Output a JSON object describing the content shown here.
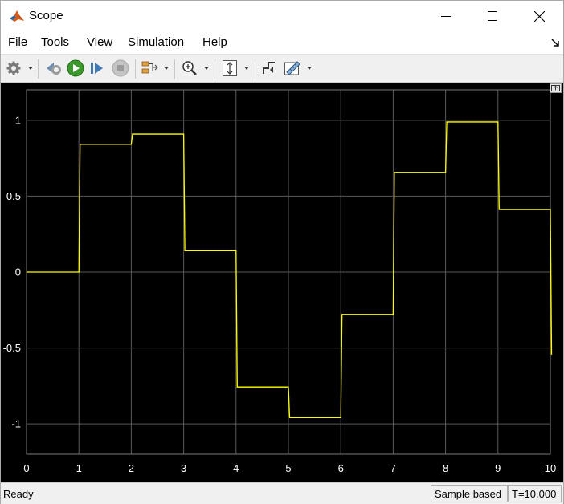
{
  "window": {
    "title": "Scope"
  },
  "menu": {
    "items": [
      "File",
      "Tools",
      "View",
      "Simulation",
      "Help"
    ]
  },
  "toolbar": {
    "icons": [
      "gear-icon",
      "step-back-icon",
      "run-icon",
      "step-forward-icon",
      "stop-icon",
      "signal-select-icon",
      "zoom-in-icon",
      "scale-axes-icon",
      "triggers-icon",
      "measurements-icon"
    ]
  },
  "status": {
    "left": "Ready",
    "mode": "Sample based",
    "time": "T=10.000"
  },
  "colors": {
    "plot_bg": "#000000",
    "grid": "#5a5a5a",
    "trace": "#ffff00",
    "tick_text": "#ffffff"
  },
  "chart_data": {
    "type": "line",
    "step": true,
    "x": [
      0,
      1,
      2,
      3,
      4,
      5,
      6,
      7,
      8,
      9,
      10
    ],
    "series": [
      {
        "values": [
          0,
          0.841,
          0.909,
          0.141,
          -0.757,
          -0.959,
          -0.279,
          0.657,
          0.989,
          0.412,
          -0.544
        ]
      }
    ],
    "xlim": [
      0,
      10
    ],
    "ylim": [
      -1.2,
      1.2
    ],
    "xticks": [
      "0",
      "1",
      "2",
      "3",
      "4",
      "5",
      "6",
      "7",
      "8",
      "9",
      "10"
    ],
    "yticks": [
      "1",
      "0.5",
      "0",
      "-0.5",
      "-1"
    ],
    "ytick_values": [
      1,
      0.5,
      0,
      -0.5,
      -1
    ],
    "grid": true
  }
}
